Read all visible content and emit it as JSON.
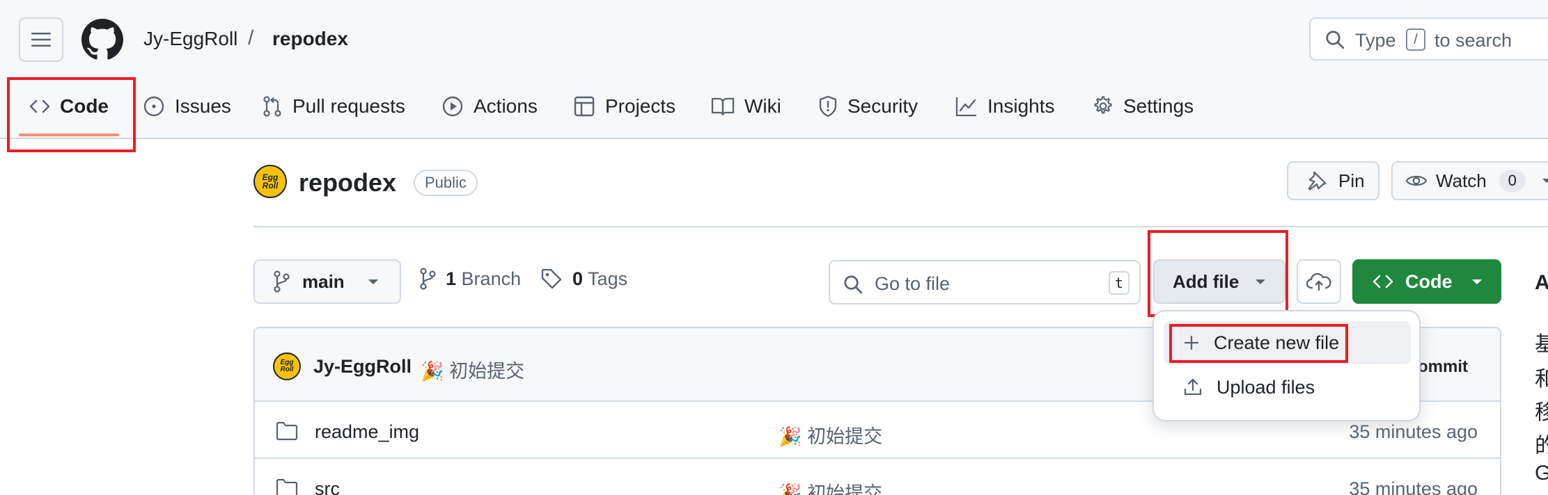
{
  "header": {
    "owner": "Jy-EggRoll",
    "separator": "/",
    "repo": "repodex",
    "search_prefix": "Type",
    "search_key": "/",
    "search_suffix": "to search"
  },
  "tabs": [
    {
      "label": "Code",
      "icon": "code-icon",
      "active": true
    },
    {
      "label": "Issues",
      "icon": "issue-icon"
    },
    {
      "label": "Pull requests",
      "icon": "pull-request-icon"
    },
    {
      "label": "Actions",
      "icon": "play-icon"
    },
    {
      "label": "Projects",
      "icon": "table-icon"
    },
    {
      "label": "Wiki",
      "icon": "book-icon"
    },
    {
      "label": "Security",
      "icon": "shield-icon"
    },
    {
      "label": "Insights",
      "icon": "graph-icon"
    },
    {
      "label": "Settings",
      "icon": "gear-icon"
    }
  ],
  "repo": {
    "avatar_text_1": "Egg",
    "avatar_text_2": "Roll",
    "name": "repodex",
    "visibility": "Public",
    "pin_label": "Pin",
    "watch_label": "Watch",
    "watch_count": "0"
  },
  "toolbar": {
    "branch": "main",
    "branches_count": "1",
    "branches_label": "Branch",
    "tags_count": "0",
    "tags_label": "Tags",
    "goto_placeholder": "Go to file",
    "goto_key": "t",
    "add_file_label": "Add file",
    "code_label": "Code"
  },
  "add_file_menu": {
    "items": [
      {
        "label": "Create new file",
        "icon": "plus-icon"
      },
      {
        "label": "Upload files",
        "icon": "upload-icon"
      }
    ]
  },
  "latest_commit": {
    "author": "Jy-EggRoll",
    "message": "🎉 初始提交",
    "right_label": "ommit"
  },
  "files": [
    {
      "name": "readme_img",
      "type": "folder",
      "message": "🎉 初始提交",
      "time": "35 minutes ago"
    },
    {
      "name": "src",
      "type": "folder",
      "message": "🎉 初始提交",
      "time": "35 minutes ago"
    }
  ],
  "sidebar_fragment": [
    "A",
    "基",
    "和",
    "移",
    "的",
    "G"
  ],
  "colors": {
    "accent_underline": "#fd8c73",
    "primary_green": "#1f883d",
    "annotation_red": "#ee1b24"
  }
}
